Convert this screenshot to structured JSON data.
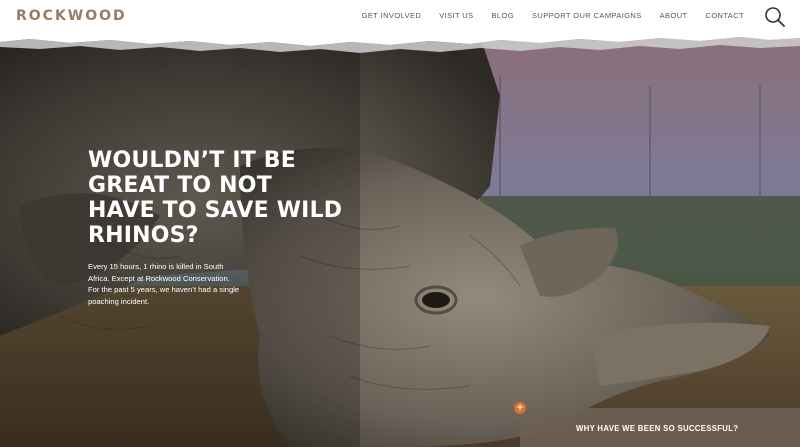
{
  "brand": {
    "logo_text": "ROCKWOOD"
  },
  "nav": {
    "items": [
      {
        "label": "GET INVOLVED"
      },
      {
        "label": "VISIT US"
      },
      {
        "label": "BLOG"
      },
      {
        "label": "SUPPORT OUR CAMPAIGNS"
      },
      {
        "label": "ABOUT"
      },
      {
        "label": "CONTACT"
      }
    ],
    "search_icon": "search-icon"
  },
  "hero": {
    "heading_lines": [
      "WOULDN’T IT BE",
      "GREAT TO NOT",
      "HAVE TO SAVE WILD",
      "RHINOS?"
    ],
    "text_lines": [
      "Every 15 hours, 1 rhino is killed in South",
      "Africa. Except at Rockwood Conservation.",
      "For the past 5 years, we haven’t had a single",
      "poaching incident."
    ],
    "image_subject": "rhino-photo"
  },
  "panel": {
    "label": "WHY HAVE WE BEEN SO SUCCESSFUL?",
    "expand_icon": "plus-icon"
  },
  "colors": {
    "brand": "#9a7a62",
    "nav_text": "#555555",
    "accent": "#d9742e",
    "panel_bg": "#6e5f55"
  }
}
